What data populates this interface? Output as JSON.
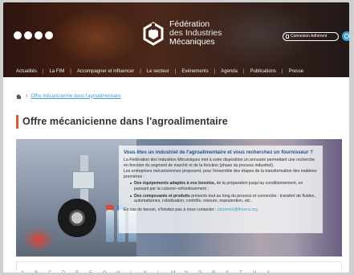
{
  "header": {
    "social_icons": [
      "social-icon-1",
      "social-icon-2",
      "social-icon-3",
      "social-icon-4"
    ],
    "logo_line1": "Fédération",
    "logo_line2": "des Industries",
    "logo_line3": "Mécaniques",
    "member_button": "Connexion Adhérent",
    "search_icon": "search-icon",
    "accent": "#3aa0d8"
  },
  "nav": {
    "items": [
      "Actualités",
      "La FIM",
      "Accompagner et influencer",
      "Le secteur",
      "Evénements",
      "Agenda",
      "Publications",
      "Presse"
    ]
  },
  "breadcrumb": {
    "home_icon": "home-icon",
    "current": "Offre mécanicienne dans l'agroalimentaire"
  },
  "page": {
    "title": "Offre mécanicienne dans l'agroalimentaire",
    "title_accent": "#e4572e"
  },
  "intro": {
    "question": "Vous êtes un industriel de l'agroalimentaire et vous recherchez un fournisseur ?",
    "p1": "La Fédération des Industries Mécaniques met à votre disposition un annuaire permettant une recherche en fonction du segment de marché et de la fonction (phase du process industriel).",
    "p2": "Les entreprises mécaniciennes proposent, pour l'ensemble des étapes de la transformation des matières premières :",
    "bullet1_strong": "Des équipements adaptés à vos besoins,",
    "bullet1_rest": " de la préparation jusqu'au conditionnement, en passant par la cuisson–refroidissement ;",
    "bullet2_strong": "Des composants et produits",
    "bullet2_rest": " présents tout au long du process et connectés : transfert de fluides, automatismes, robotisation, contrôle, mesure, manutention, etc.",
    "contact_text": "En cas de besoin, n'hésitez pas à nous contacter : ",
    "contact_email": "plepretre@fimeca.org"
  },
  "alphabet": [
    "A",
    "B",
    "C",
    "D",
    "E",
    "F",
    "G",
    "H",
    "I",
    "K",
    "L",
    "M",
    "N",
    "P",
    "R",
    "S",
    "T",
    "V",
    "X"
  ]
}
